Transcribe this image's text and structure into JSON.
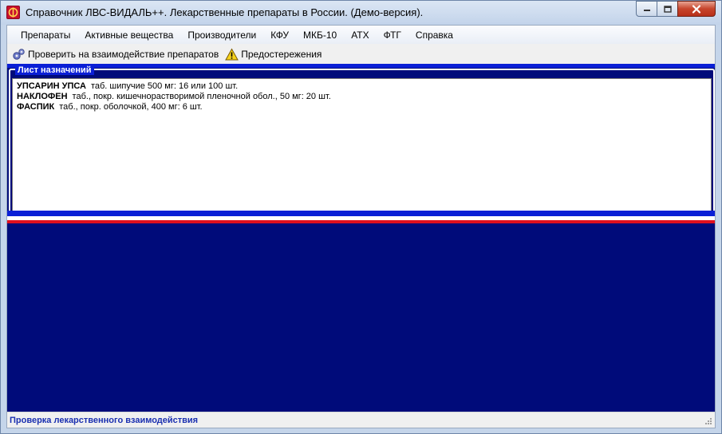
{
  "window": {
    "title": "Справочник ЛВС-ВИДАЛЬ++. Лекарственные препараты в России. (Демо-версия).",
    "app_icon": "vidal-logo-icon",
    "controls": [
      "minimize-icon",
      "maximize-icon",
      "close-icon"
    ]
  },
  "menu": {
    "items": [
      {
        "label": "Препараты"
      },
      {
        "label": "Активные вещества"
      },
      {
        "label": "Производители"
      },
      {
        "label": "КФУ"
      },
      {
        "label": "МКБ-10"
      },
      {
        "label": "АТХ"
      },
      {
        "label": "ФТГ"
      },
      {
        "label": "Справка"
      }
    ]
  },
  "toolbar": {
    "check_label": "Проверить на взаимодействие препаратов",
    "check_icon": "gears-icon",
    "warnings_label": "Предостережения",
    "warnings_icon": "warning-icon"
  },
  "prescription": {
    "title": "Лист назначений",
    "items": [
      {
        "name": "УПСАРИН УПСА",
        "form": "таб. шипучие 500 мг: 16 или 100 шт."
      },
      {
        "name": "НАКЛОФЕН",
        "form": "таб., покр. кишечнорастворимой пленочной обол., 50 мг: 20 шт."
      },
      {
        "name": "ФАСПИК",
        "form": "таб., покр. оболочкой, 400 мг: 6 шт."
      }
    ]
  },
  "status": {
    "text": "Проверка лекарственного взаимодействия"
  },
  "colors": {
    "panel_dark": "#000b7a",
    "flag_blue": "#0a1fd6",
    "flag_red": "#e0101e",
    "status_text": "#1a2fb0"
  }
}
